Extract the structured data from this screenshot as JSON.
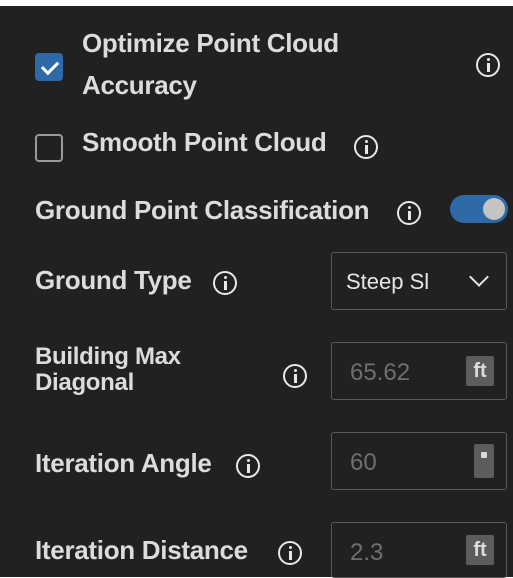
{
  "settings": {
    "optimize_accuracy": {
      "label_line1": "Optimize Point Cloud",
      "label_line2": "Accuracy",
      "checked": true
    },
    "smooth_point_cloud": {
      "label": "Smooth Point Cloud",
      "checked": false
    },
    "ground_classification": {
      "label": "Ground Point Classification",
      "enabled": true
    },
    "ground_type": {
      "label": "Ground Type",
      "value": "Steep Sl"
    },
    "building_max_diagonal": {
      "label_line1": "Building Max",
      "label_line2": "Diagonal",
      "value": "65.62",
      "unit": "ft"
    },
    "iteration_angle": {
      "label": "Iteration Angle",
      "value": "60"
    },
    "iteration_distance": {
      "label": "Iteration Distance",
      "value": "2.3",
      "unit": "ft"
    }
  },
  "colors": {
    "panel_bg": "#212121",
    "accent": "#2f6aa8",
    "text": "#dcdcdc",
    "muted_value": "#6f6f6f"
  }
}
